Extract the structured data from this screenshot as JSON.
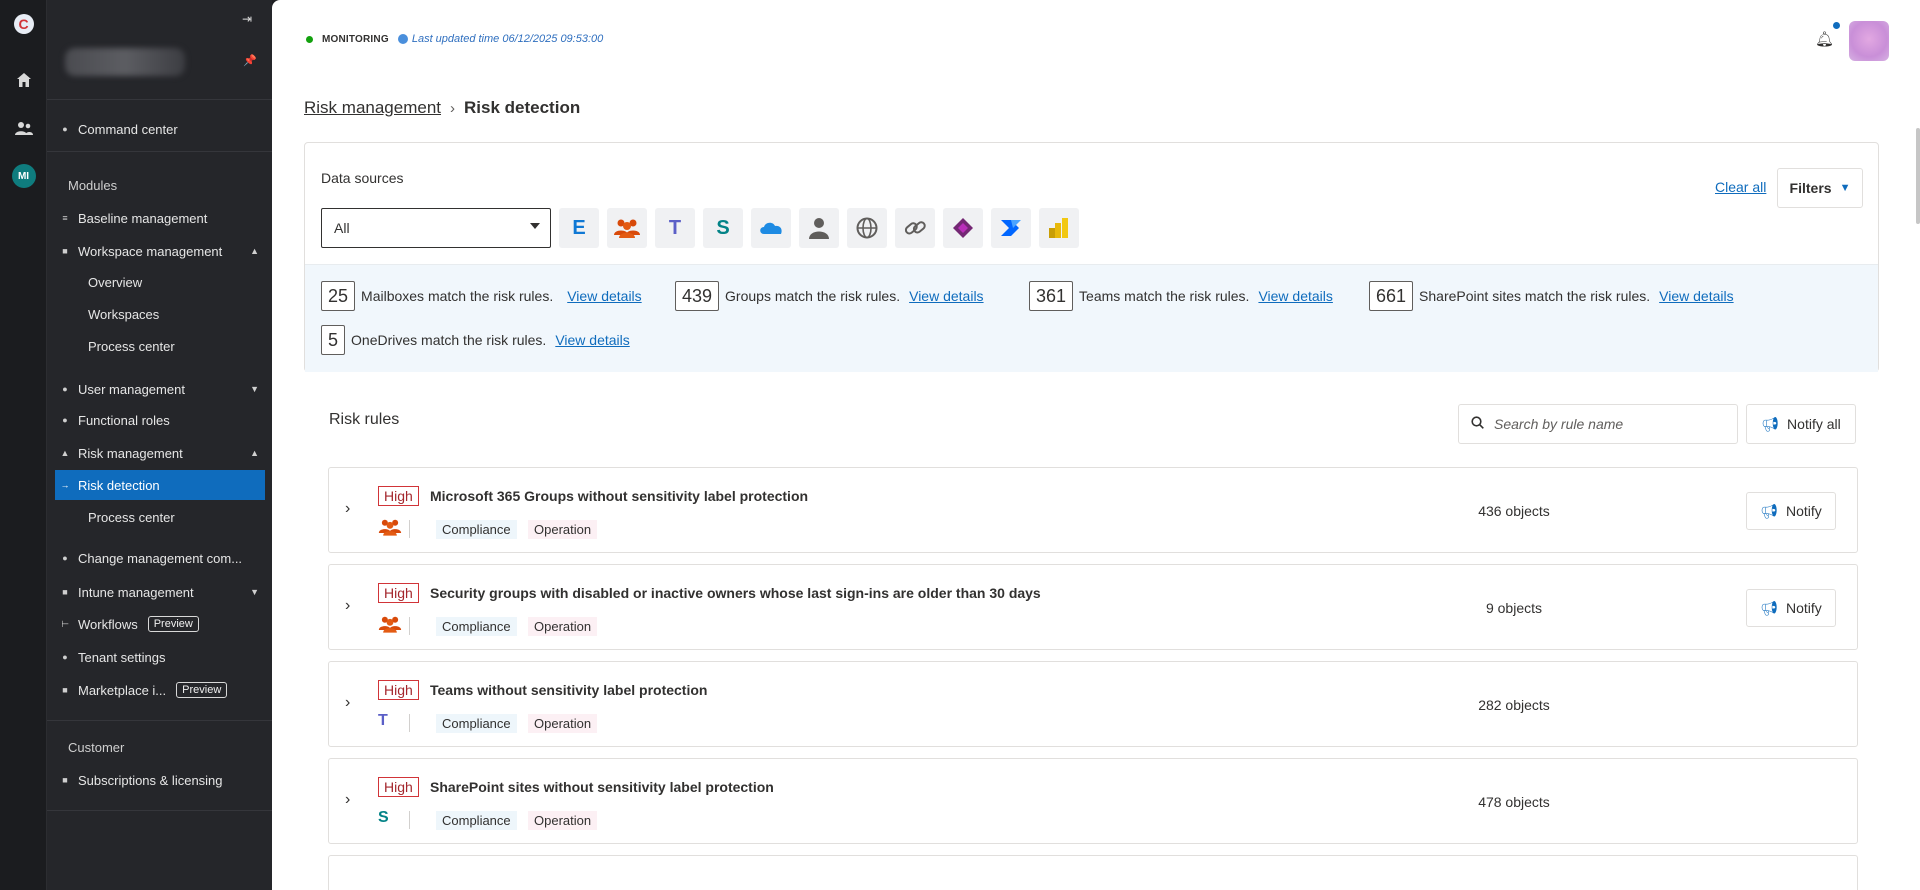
{
  "rail": {
    "logo": "C",
    "mi_badge": "MI"
  },
  "sidebar": {
    "command_center": "Command center",
    "modules_heading": "Modules",
    "baseline": "Baseline management",
    "workspace_mgmt": "Workspace management",
    "overview": "Overview",
    "workspaces": "Workspaces",
    "process_center_1": "Process center",
    "user_mgmt": "User management",
    "functional_roles": "Functional roles",
    "risk_mgmt": "Risk management",
    "risk_detection": "Risk detection",
    "process_center_2": "Process center",
    "change_mgmt": "Change management com...",
    "intune_mgmt": "Intune management",
    "workflows": "Workflows",
    "workflows_badge": "Preview",
    "tenant_settings": "Tenant settings",
    "marketplace": "Marketplace i...",
    "marketplace_badge": "Preview",
    "customer_heading": "Customer",
    "subscriptions": "Subscriptions & licensing"
  },
  "header": {
    "monitoring": "MONITORING",
    "last_updated": "Last updated time 06/12/2025 09:53:00"
  },
  "breadcrumb": {
    "parent": "Risk management",
    "current": "Risk detection"
  },
  "data_sources": {
    "title": "Data sources",
    "select_value": "All",
    "clear_all": "Clear all",
    "filters": "Filters",
    "icons": [
      "exchange-icon",
      "groups-icon",
      "teams-icon",
      "sharepoint-icon",
      "onedrive-icon",
      "user-icon",
      "web-icon",
      "link-icon",
      "power-apps-icon",
      "power-automate-icon",
      "power-bi-icon"
    ]
  },
  "summary": {
    "mailboxes": {
      "count": "25",
      "text": "Mailboxes match the risk rules.",
      "link": "View details"
    },
    "groups": {
      "count": "439",
      "text": "Groups match the risk rules.",
      "link": "View details"
    },
    "teams": {
      "count": "361",
      "text": "Teams match the risk rules.",
      "link": "View details"
    },
    "sharepoint": {
      "count": "661",
      "text": "SharePoint sites match the risk rules.",
      "link": "View details"
    },
    "onedrives": {
      "count": "5",
      "text": "OneDrives match the risk rules.",
      "link": "View details"
    }
  },
  "risk_rules": {
    "title": "Risk rules",
    "search_placeholder": "Search by rule name",
    "notify_all": "Notify all",
    "rules": [
      {
        "severity": "High",
        "name": "Microsoft 365 Groups without sensitivity label protection",
        "workload_icon": "groups-icon",
        "tags": [
          "Compliance",
          "Operation"
        ],
        "objects": "436 objects",
        "notify": "Notify"
      },
      {
        "severity": "High",
        "name": "Security groups with disabled or inactive owners whose last sign-ins are older than 30 days",
        "workload_icon": "groups-icon",
        "tags": [
          "Compliance",
          "Operation"
        ],
        "objects": "9 objects",
        "notify": "Notify"
      },
      {
        "severity": "High",
        "name": "Teams without sensitivity label protection",
        "workload_icon": "teams-icon",
        "tags": [
          "Compliance",
          "Operation"
        ],
        "objects": "282 objects"
      },
      {
        "severity": "High",
        "name": "SharePoint sites without sensitivity label protection",
        "workload_icon": "sharepoint-icon",
        "tags": [
          "Compliance",
          "Operation"
        ],
        "objects": "478 objects"
      }
    ]
  },
  "colors": {
    "accent": "#0f6cbd",
    "sidebar_bg": "#25262a",
    "severity_high": "#d13438"
  }
}
